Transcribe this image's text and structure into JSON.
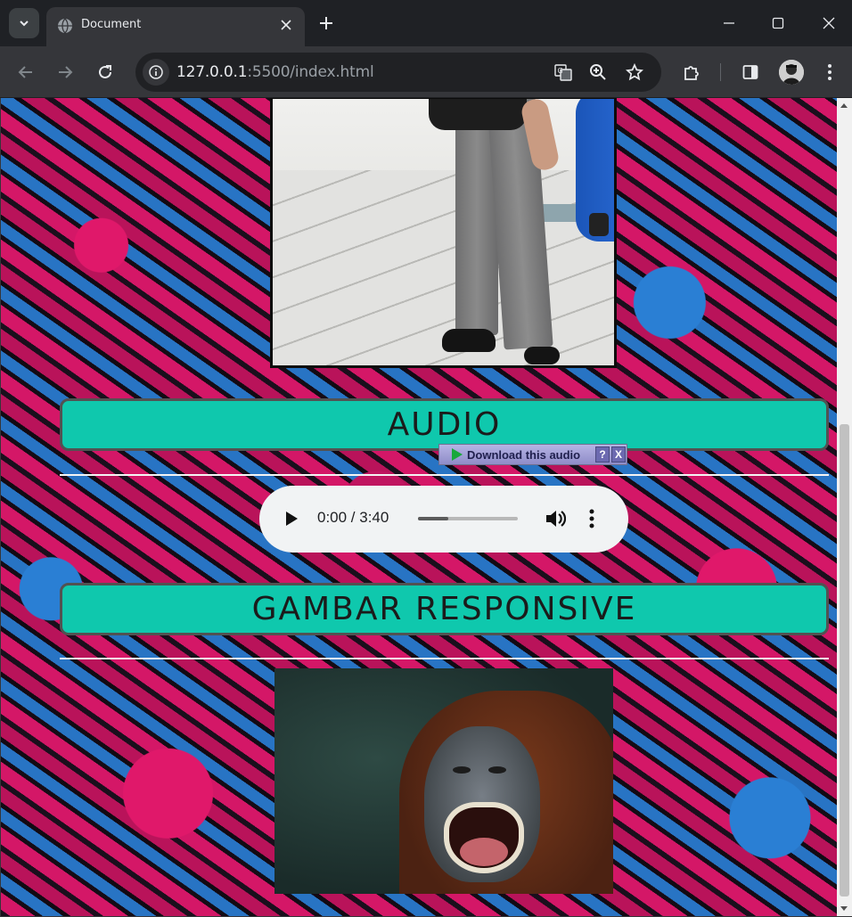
{
  "browser": {
    "tab_title": "Document",
    "url_host": "127.0.0.1",
    "url_rest": ":5500/index.html"
  },
  "page": {
    "audio_heading": "AUDIO",
    "download_bar_label": "Download this audio",
    "download_help": "?",
    "download_close": "X",
    "audio_player": {
      "time": "0:00 / 3:40",
      "progress_fraction": 0.3
    },
    "image_heading": "GAMBAR RESPONSIVE"
  },
  "colors": {
    "heading_bg": "#0fc8ad",
    "background_pink": "#e0186a",
    "background_blue": "#2a7fd4"
  }
}
